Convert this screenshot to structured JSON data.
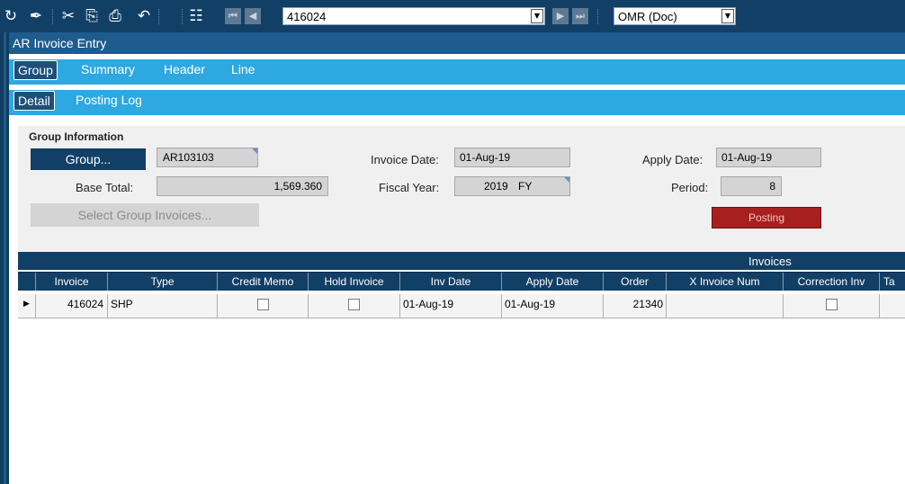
{
  "toolbar": {
    "icons": [
      "refresh-icon",
      "brush-icon",
      "cut-icon",
      "copy-icon",
      "paste-icon",
      "undo-icon",
      "binoculars-icon",
      "first-record-icon",
      "previous-record-icon",
      "next-record-icon",
      "last-record-icon"
    ],
    "record_combo_value": "416024",
    "currency_combo_value": "OMR (Doc)"
  },
  "window": {
    "title": "AR Invoice Entry"
  },
  "tabs_main": [
    {
      "label": "Group",
      "active": true
    },
    {
      "label": "Summary",
      "active": false
    },
    {
      "label": "Header",
      "active": false
    },
    {
      "label": "Line",
      "active": false
    }
  ],
  "tabs_sub": [
    {
      "label": "Detail",
      "active": true
    },
    {
      "label": "Posting Log",
      "active": false
    }
  ],
  "group_info": {
    "section_title": "Group Information",
    "group_button": "Group...",
    "group_value": "AR103103",
    "base_total_label": "Base Total:",
    "base_total_value": "1,569.360",
    "select_invoices_button": "Select Group Invoices...",
    "invoice_date_label": "Invoice Date:",
    "invoice_date_value": "01-Aug-19",
    "fiscal_year_label": "Fiscal Year:",
    "fiscal_year_value": "2019",
    "fiscal_year_suffix": "FY",
    "apply_date_label": "Apply Date:",
    "apply_date_value": "01-Aug-19",
    "period_label": "Period:",
    "period_value": "8",
    "posting_button": "Posting"
  },
  "grid": {
    "caption": "Invoices",
    "columns": [
      "Invoice",
      "Type",
      "Credit Memo",
      "Hold Invoice",
      "Inv Date",
      "Apply Date",
      "Order",
      "X Invoice Num",
      "Correction Inv",
      "Ta"
    ],
    "rows": [
      {
        "invoice": "416024",
        "type": "SHP",
        "credit_memo": false,
        "hold_invoice": false,
        "inv_date": "01-Aug-19",
        "apply_date": "01-Aug-19",
        "order": "21340",
        "x_invoice_num": "",
        "correction_inv": false
      }
    ]
  },
  "colors": {
    "toolbar_bg": "#123f66",
    "title_bg": "#1e5c8e",
    "tab_bg": "#2ea8e0",
    "posting_red": "#a81f1f"
  }
}
